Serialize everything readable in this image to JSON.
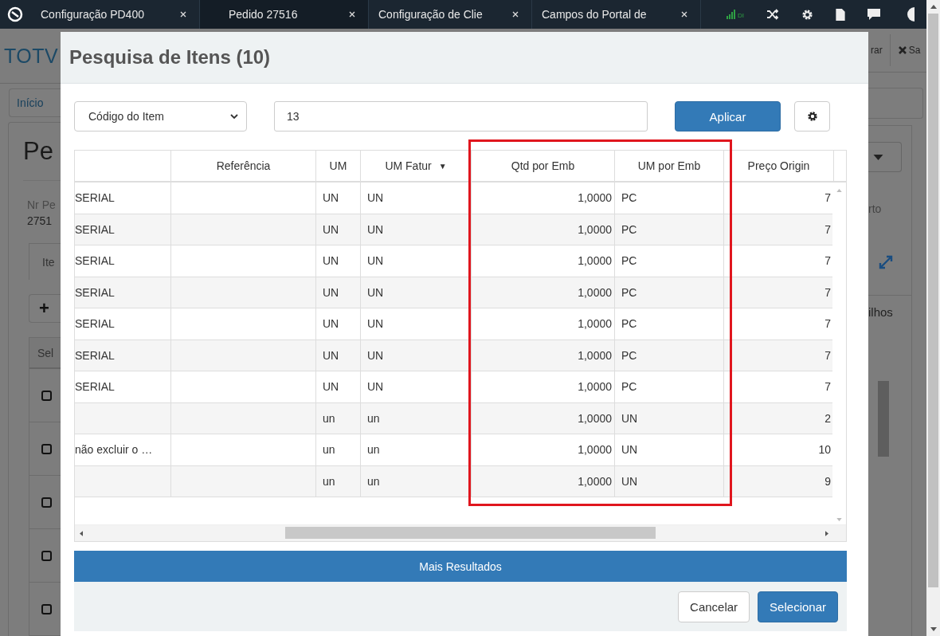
{
  "browser_tabs": [
    {
      "label": "Configuração PD400",
      "selected": false
    },
    {
      "label": "Pedido 27516",
      "selected": true
    },
    {
      "label": "Configuração de Clie",
      "selected": false
    },
    {
      "label": "Campos do Portal de",
      "selected": false
    }
  ],
  "toolbar": {
    "signal_label": "DI"
  },
  "background_page": {
    "logo": "TOTV",
    "right_buttons": [
      "rar",
      "Sa"
    ],
    "breadcrumb": "Início",
    "title": "Pe",
    "field_label": "Nr Pe",
    "field_value": "2751",
    "right_text_1": "rto",
    "tab": "Ite",
    "add_button": "+",
    "right_text_2": "ilhos",
    "grid_header": "Sel",
    "grid_rows": [
      {
        "checked": false
      },
      {
        "checked": false
      },
      {
        "checked": false
      },
      {
        "checked": false
      },
      {
        "checked": false
      }
    ]
  },
  "modal": {
    "title": "Pesquisa de Itens (10)",
    "filter_select": "Código do Item",
    "search_value": "13",
    "apply_button": "Aplicar",
    "columns": [
      {
        "label": "Referência",
        "highlighted": false
      },
      {
        "label": "UM",
        "highlighted": false
      },
      {
        "label": "UM Fatur",
        "sort_mark": "▼",
        "highlighted": false
      },
      {
        "label": "Qtd por Emb",
        "highlighted": true
      },
      {
        "label": "UM por Emb",
        "highlighted": true
      },
      {
        "label": "Preço Origin",
        "highlighted": false
      }
    ],
    "rows": [
      {
        "column_1": "SERIAL",
        "um": "UN",
        "um_fatur": "UN",
        "qtd_por_emb": "1,0000",
        "um_por_emb": "PC",
        "preco_origin": "7"
      },
      {
        "column_1": "SERIAL",
        "um": "UN",
        "um_fatur": "UN",
        "qtd_por_emb": "1,0000",
        "um_por_emb": "PC",
        "preco_origin": "7"
      },
      {
        "column_1": "SERIAL",
        "um": "UN",
        "um_fatur": "UN",
        "qtd_por_emb": "1,0000",
        "um_por_emb": "PC",
        "preco_origin": "7"
      },
      {
        "column_1": "SERIAL",
        "um": "UN",
        "um_fatur": "UN",
        "qtd_por_emb": "1,0000",
        "um_por_emb": "PC",
        "preco_origin": "7"
      },
      {
        "column_1": "SERIAL",
        "um": "UN",
        "um_fatur": "UN",
        "qtd_por_emb": "1,0000",
        "um_por_emb": "PC",
        "preco_origin": "7"
      },
      {
        "column_1": "SERIAL",
        "um": "UN",
        "um_fatur": "UN",
        "qtd_por_emb": "1,0000",
        "um_por_emb": "PC",
        "preco_origin": "7"
      },
      {
        "column_1": "SERIAL",
        "um": "UN",
        "um_fatur": "UN",
        "qtd_por_emb": "1,0000",
        "um_por_emb": "PC",
        "preco_origin": "7"
      },
      {
        "um": "un",
        "um_fatur": "un",
        "qtd_por_emb": "1,0000",
        "um_por_emb": "UN",
        "preco_origin": "2"
      },
      {
        "column_1": "não excluir o …",
        "um": "un",
        "um_fatur": "un",
        "qtd_por_emb": "1,0000",
        "um_por_emb": "UN",
        "preco_origin": "10"
      },
      {
        "um": "un",
        "um_fatur": "un",
        "qtd_por_emb": "1,0000",
        "um_por_emb": "UN",
        "preco_origin": "9"
      }
    ],
    "more_button": "Mais Resultados",
    "buttons": [
      {
        "label": "Cancelar",
        "kind": "secondary"
      },
      {
        "label": "Selecionar",
        "kind": "primary"
      }
    ]
  }
}
